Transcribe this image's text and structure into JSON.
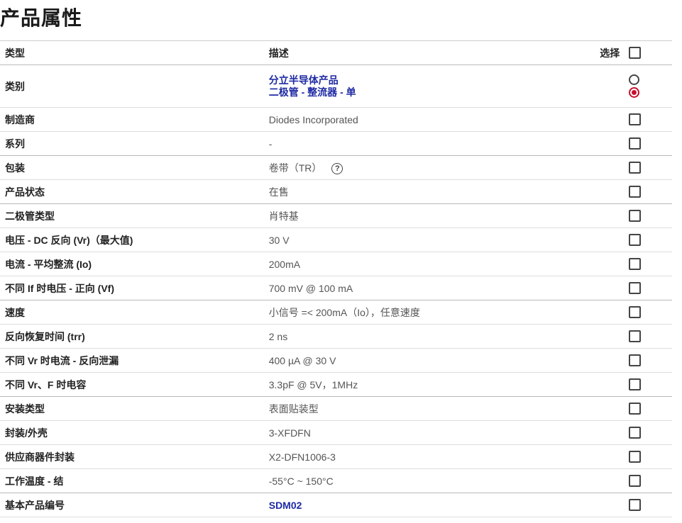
{
  "page_title": "产品属性",
  "header": {
    "type": "类型",
    "description": "描述",
    "select": "选择"
  },
  "category": {
    "label": "类别",
    "line1": "分立半导体产品",
    "line2": "二极管 - 整流器 - 单"
  },
  "rows": [
    {
      "type": "制造商",
      "value": "Diodes Incorporated"
    },
    {
      "type": "系列",
      "value": "-"
    },
    {
      "type": "包装",
      "value": "卷带（TR）",
      "help_icon": "question-circle-icon"
    },
    {
      "type": "产品状态",
      "value": "在售"
    },
    {
      "type": "二极管类型",
      "value": "肖特基"
    },
    {
      "type": "电压 - DC 反向 (Vr)（最大值)",
      "value": "30 V"
    },
    {
      "type": "电流 - 平均整流 (Io)",
      "value": "200mA"
    },
    {
      "type": "不同 If 时电压 - 正向 (Vf)",
      "value": "700 mV @ 100 mA"
    },
    {
      "type": "速度",
      "value": "小信号 =< 200mA（Io），任意速度"
    },
    {
      "type": "反向恢复时间 (trr)",
      "value": "2 ns"
    },
    {
      "type": "不同 Vr 时电流 - 反向泄漏",
      "value": "400 µA @ 30 V"
    },
    {
      "type": "不同 Vr、F 时电容",
      "value": "3.3pF @ 5V，1MHz"
    },
    {
      "type": "安装类型",
      "value": "表面贴装型"
    },
    {
      "type": "封装/外壳",
      "value": "3-XFDFN"
    },
    {
      "type": "供应商器件封装",
      "value": "X2-DFN1006-3"
    },
    {
      "type": "工作温度 - 结",
      "value": "-55°C ~ 150°C"
    },
    {
      "type": "基本产品编号",
      "value": "SDM02"
    }
  ],
  "colors": {
    "link": "#1e2aa3",
    "radio_selected": "#c8102e"
  }
}
